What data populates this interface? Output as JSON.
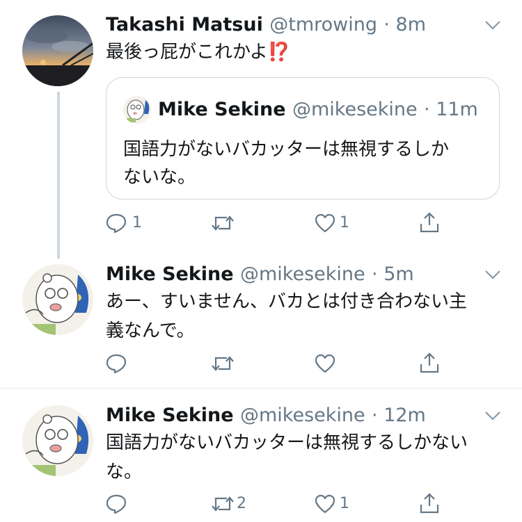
{
  "tweets": [
    {
      "name": "Takashi Matsui",
      "handle": "@tmrowing",
      "time": "· 8m",
      "text_lines": [
        "最後っ屁がこれかよ⁉️"
      ],
      "actions": {
        "reply_count": "1",
        "retweet_count": "",
        "like_count": "1"
      }
    },
    {
      "name": "Mike Sekine",
      "handle": "@mikesekine",
      "time": "· 5m",
      "text_lines": [
        "あー、すいません、バカとは付き合わない主",
        "義なんで。"
      ],
      "actions": {
        "reply_count": "",
        "retweet_count": "",
        "like_count": ""
      }
    },
    {
      "name": "Mike Sekine",
      "handle": "@mikesekine",
      "time": "· 12m",
      "text_lines": [
        "国語力がないバカッターは無視するしかない",
        "な。"
      ],
      "actions": {
        "reply_count": "",
        "retweet_count": "2",
        "like_count": "1"
      }
    }
  ],
  "quoted_tweet": {
    "name": "Mike Sekine",
    "handle": "@mikesekine",
    "time": "· 11m",
    "text_lines": [
      "国語力がないバカッターは無視するしか",
      "ないな。"
    ]
  },
  "icons": {
    "reply": "reply-icon",
    "retweet": "retweet-icon",
    "like": "heart-icon",
    "share": "share-icon",
    "more": "chevron-down-icon"
  },
  "colors": {
    "text": "#14171a",
    "secondary": "#657786",
    "border": "#ccd6dd",
    "divider": "#e6ecf0"
  }
}
